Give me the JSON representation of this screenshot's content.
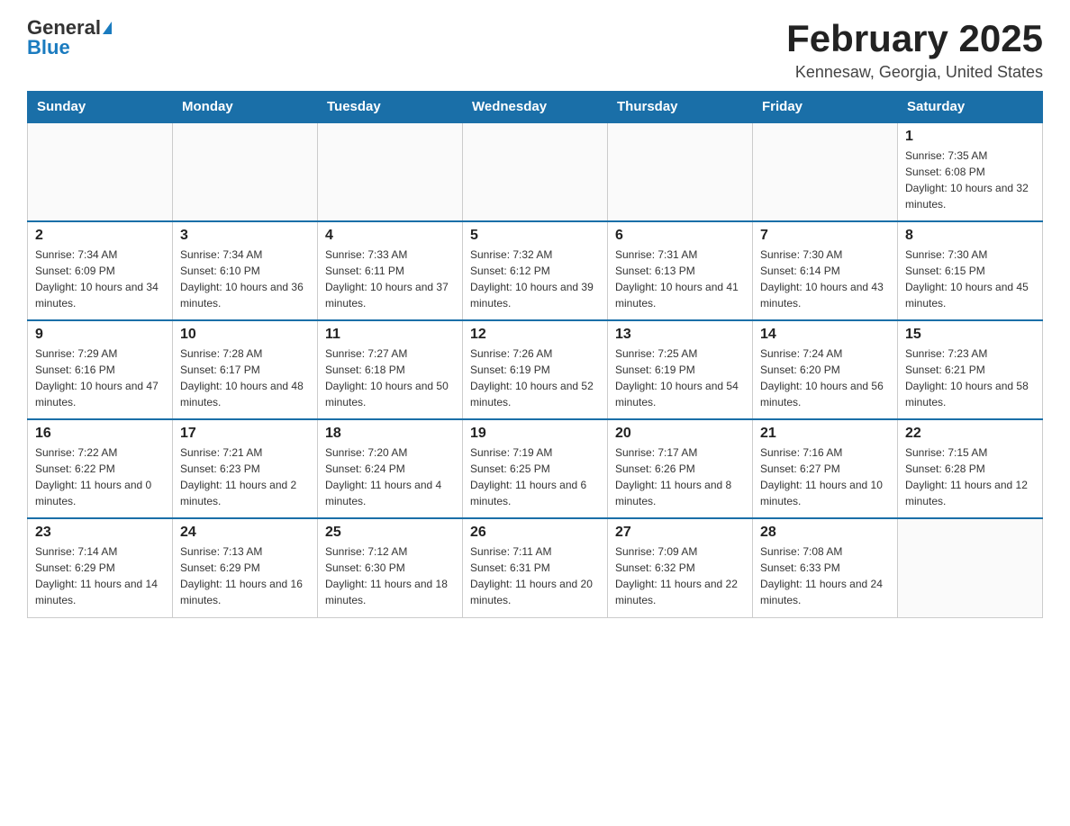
{
  "header": {
    "logo_general": "General",
    "logo_blue": "Blue",
    "title": "February 2025",
    "location": "Kennesaw, Georgia, United States"
  },
  "days_of_week": [
    "Sunday",
    "Monday",
    "Tuesday",
    "Wednesday",
    "Thursday",
    "Friday",
    "Saturday"
  ],
  "weeks": [
    [
      {
        "num": "",
        "info": ""
      },
      {
        "num": "",
        "info": ""
      },
      {
        "num": "",
        "info": ""
      },
      {
        "num": "",
        "info": ""
      },
      {
        "num": "",
        "info": ""
      },
      {
        "num": "",
        "info": ""
      },
      {
        "num": "1",
        "info": "Sunrise: 7:35 AM\nSunset: 6:08 PM\nDaylight: 10 hours and 32 minutes."
      }
    ],
    [
      {
        "num": "2",
        "info": "Sunrise: 7:34 AM\nSunset: 6:09 PM\nDaylight: 10 hours and 34 minutes."
      },
      {
        "num": "3",
        "info": "Sunrise: 7:34 AM\nSunset: 6:10 PM\nDaylight: 10 hours and 36 minutes."
      },
      {
        "num": "4",
        "info": "Sunrise: 7:33 AM\nSunset: 6:11 PM\nDaylight: 10 hours and 37 minutes."
      },
      {
        "num": "5",
        "info": "Sunrise: 7:32 AM\nSunset: 6:12 PM\nDaylight: 10 hours and 39 minutes."
      },
      {
        "num": "6",
        "info": "Sunrise: 7:31 AM\nSunset: 6:13 PM\nDaylight: 10 hours and 41 minutes."
      },
      {
        "num": "7",
        "info": "Sunrise: 7:30 AM\nSunset: 6:14 PM\nDaylight: 10 hours and 43 minutes."
      },
      {
        "num": "8",
        "info": "Sunrise: 7:30 AM\nSunset: 6:15 PM\nDaylight: 10 hours and 45 minutes."
      }
    ],
    [
      {
        "num": "9",
        "info": "Sunrise: 7:29 AM\nSunset: 6:16 PM\nDaylight: 10 hours and 47 minutes."
      },
      {
        "num": "10",
        "info": "Sunrise: 7:28 AM\nSunset: 6:17 PM\nDaylight: 10 hours and 48 minutes."
      },
      {
        "num": "11",
        "info": "Sunrise: 7:27 AM\nSunset: 6:18 PM\nDaylight: 10 hours and 50 minutes."
      },
      {
        "num": "12",
        "info": "Sunrise: 7:26 AM\nSunset: 6:19 PM\nDaylight: 10 hours and 52 minutes."
      },
      {
        "num": "13",
        "info": "Sunrise: 7:25 AM\nSunset: 6:19 PM\nDaylight: 10 hours and 54 minutes."
      },
      {
        "num": "14",
        "info": "Sunrise: 7:24 AM\nSunset: 6:20 PM\nDaylight: 10 hours and 56 minutes."
      },
      {
        "num": "15",
        "info": "Sunrise: 7:23 AM\nSunset: 6:21 PM\nDaylight: 10 hours and 58 minutes."
      }
    ],
    [
      {
        "num": "16",
        "info": "Sunrise: 7:22 AM\nSunset: 6:22 PM\nDaylight: 11 hours and 0 minutes."
      },
      {
        "num": "17",
        "info": "Sunrise: 7:21 AM\nSunset: 6:23 PM\nDaylight: 11 hours and 2 minutes."
      },
      {
        "num": "18",
        "info": "Sunrise: 7:20 AM\nSunset: 6:24 PM\nDaylight: 11 hours and 4 minutes."
      },
      {
        "num": "19",
        "info": "Sunrise: 7:19 AM\nSunset: 6:25 PM\nDaylight: 11 hours and 6 minutes."
      },
      {
        "num": "20",
        "info": "Sunrise: 7:17 AM\nSunset: 6:26 PM\nDaylight: 11 hours and 8 minutes."
      },
      {
        "num": "21",
        "info": "Sunrise: 7:16 AM\nSunset: 6:27 PM\nDaylight: 11 hours and 10 minutes."
      },
      {
        "num": "22",
        "info": "Sunrise: 7:15 AM\nSunset: 6:28 PM\nDaylight: 11 hours and 12 minutes."
      }
    ],
    [
      {
        "num": "23",
        "info": "Sunrise: 7:14 AM\nSunset: 6:29 PM\nDaylight: 11 hours and 14 minutes."
      },
      {
        "num": "24",
        "info": "Sunrise: 7:13 AM\nSunset: 6:29 PM\nDaylight: 11 hours and 16 minutes."
      },
      {
        "num": "25",
        "info": "Sunrise: 7:12 AM\nSunset: 6:30 PM\nDaylight: 11 hours and 18 minutes."
      },
      {
        "num": "26",
        "info": "Sunrise: 7:11 AM\nSunset: 6:31 PM\nDaylight: 11 hours and 20 minutes."
      },
      {
        "num": "27",
        "info": "Sunrise: 7:09 AM\nSunset: 6:32 PM\nDaylight: 11 hours and 22 minutes."
      },
      {
        "num": "28",
        "info": "Sunrise: 7:08 AM\nSunset: 6:33 PM\nDaylight: 11 hours and 24 minutes."
      },
      {
        "num": "",
        "info": ""
      }
    ]
  ]
}
